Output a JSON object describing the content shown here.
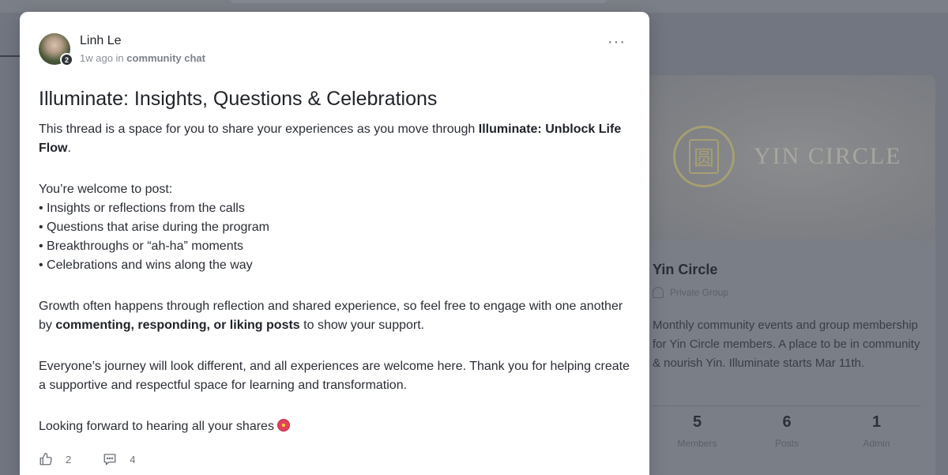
{
  "background": {
    "group": {
      "banner_text": "YIN CIRCLE",
      "name": "Yin Circle",
      "privacy": "Private Group",
      "description": "Monthly community events and group membership for Yin Circle members. A place to be in community & nourish Yin. Illuminate starts Mar 11th.",
      "stats": [
        {
          "value": "5",
          "label": "Members"
        },
        {
          "value": "6",
          "label": "Posts"
        },
        {
          "value": "1",
          "label": "Admin"
        }
      ]
    }
  },
  "post": {
    "author": "Linh Le",
    "avatar_badge": "2",
    "time": "1w ago",
    "in_label": "in",
    "space": "community chat",
    "more_icon": "ellipsis-icon",
    "title": "Illuminate: Insights, Questions & Celebrations",
    "intro": "This thread is a space for you to share your experiences as you move through ",
    "intro_bold": "Illuminate: Unblock Life Flow",
    "intro_end": ".",
    "welcome": "You’re welcome to post:",
    "bullets": [
      "• Insights or reflections from the calls",
      "• Questions that arise during the program",
      "• Breakthroughs or “ah-ha” moments",
      "• Celebrations and wins along the way"
    ],
    "growth_start": "Growth often happens through reflection and shared experience, so feel free to engage with one another by ",
    "growth_bold": "commenting, responding, or liking posts",
    "growth_end": " to show your support.",
    "journey": "Everyone’s journey will look different, and all experiences are welcome here. Thank you for helping create a supportive and respectful space for learning and transformation.",
    "closing": "Looking forward to hearing all your shares",
    "closing_emoji": "hibiscus-icon",
    "likes": "2",
    "comments": "4"
  }
}
